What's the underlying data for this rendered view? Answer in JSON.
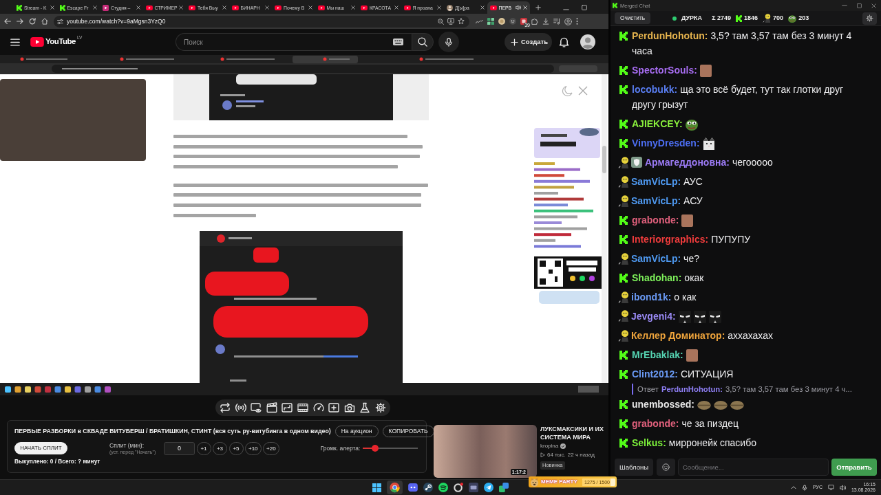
{
  "browser": {
    "tabs": [
      {
        "title": "Stream - K",
        "kind": "k",
        "selected": false,
        "audible": false
      },
      {
        "title": "Escape Fr",
        "kind": "k",
        "selected": false,
        "audible": false
      },
      {
        "title": "Студия –",
        "kind": "studio",
        "selected": false,
        "audible": false
      },
      {
        "title": "СТРИМЕР",
        "kind": "play",
        "selected": false,
        "audible": false
      },
      {
        "title": "Тебя Выу",
        "kind": "play",
        "selected": false,
        "audible": false
      },
      {
        "title": "БИНАРН",
        "kind": "play",
        "selected": false,
        "audible": false
      },
      {
        "title": "Почему В",
        "kind": "play",
        "selected": false,
        "audible": false
      },
      {
        "title": "Мы наш",
        "kind": "play",
        "selected": false,
        "audible": false
      },
      {
        "title": "КРАСОТА",
        "kind": "play",
        "selected": false,
        "audible": false
      },
      {
        "title": "Я проана",
        "kind": "play",
        "selected": false,
        "audible": false
      },
      {
        "title": "Д[ы]ра",
        "kind": "avatar",
        "selected": false,
        "audible": false
      },
      {
        "title": "ПЕРВ",
        "kind": "play",
        "selected": true,
        "audible": true
      }
    ],
    "address": "youtube.com/watch?v=9aMgsn3YzQ0",
    "extension_count": "39"
  },
  "youtube": {
    "logo": "YouTube",
    "region": "LV",
    "search": {
      "placeholder": "Поиск"
    },
    "create_button": "Создать"
  },
  "panel": {
    "title": "ПЕРВЫЕ РАЗБОРКИ в СКВАДЕ ВИТУБЕРШ / БРАТИШКИН, СТИНТ (вся суть ру-витубинга в одном видео)",
    "auction_button": "На аукцион",
    "copy_button": "КОПИРОВАТЬ",
    "start_button": "НАЧАТЬ СПЛИТ",
    "split_label": "Сплит (мин):",
    "split_hint": "(уст. перед \"Начать\")",
    "split_value": "0",
    "increments": [
      "+1",
      "+3",
      "+5",
      "+10",
      "+20"
    ],
    "alert_label": "Громк. алерта:",
    "alert_volume": {
      "level": 0.22
    },
    "bought": "Выкуплено: 0 / Всего: ? минут"
  },
  "recommendation": {
    "title": "ЛУКСМАКСИКИ И ИХ СИСТЕМА МИРА",
    "duration": "1:17:2",
    "channel": "kropina",
    "verified": true,
    "views": "64 тыс.",
    "age": "22 ч назад",
    "tag": "Новинка"
  },
  "chat": {
    "title": "Merged Chat",
    "clear_button": "Очистить",
    "online": true,
    "channel": "ДУРКА",
    "total": "Σ 2749",
    "counts": [
      {
        "kind": "k",
        "value": "1846"
      },
      {
        "kind": "mascot",
        "value": "700"
      },
      {
        "kind": "frog",
        "value": "203"
      }
    ],
    "messages": [
      {
        "kind": "message",
        "badges": [
          {
            "kind": "k"
          }
        ],
        "user": "PerdunHohotun:",
        "color": "#e6b44e",
        "text": "3,5? там 3,57 там без 3 минут 4 часа"
      },
      {
        "kind": "message",
        "badges": [
          {
            "kind": "k"
          }
        ],
        "user": "SpectorSouls:",
        "color": "#a66cf0",
        "emotes": [
          {
            "kind": "face"
          }
        ]
      },
      {
        "kind": "message",
        "badges": [
          {
            "kind": "k"
          }
        ],
        "user": "locobukk:",
        "color": "#5a7ff5",
        "text": "ща это всё будет, тут так глотки друг другу грызут"
      },
      {
        "kind": "message",
        "badges": [
          {
            "kind": "k"
          }
        ],
        "user": "AJIEKCEY:",
        "color": "#8af03c",
        "emotes": [
          {
            "kind": "frog"
          }
        ]
      },
      {
        "kind": "message",
        "badges": [
          {
            "kind": "k"
          }
        ],
        "user": "VinnyDresden:",
        "color": "#4d6ff5",
        "emotes": [
          {
            "kind": "cat"
          }
        ]
      },
      {
        "kind": "message",
        "badges": [
          {
            "kind": "mascot"
          },
          {
            "kind": "shield"
          }
        ],
        "user": "Армагеддоновна:",
        "color": "#9d7cf8",
        "text": "чегооооо"
      },
      {
        "kind": "message",
        "badges": [
          {
            "kind": "mascot"
          }
        ],
        "user": "SamVicLp:",
        "color": "#4f9af2",
        "text": "АУС"
      },
      {
        "kind": "message",
        "badges": [
          {
            "kind": "mascot"
          }
        ],
        "user": "SamVicLp:",
        "color": "#4f9af2",
        "text": "АСУ"
      },
      {
        "kind": "message",
        "badges": [
          {
            "kind": "k"
          }
        ],
        "user": "grabonde:",
        "color": "#e0607c",
        "emotes": [
          {
            "kind": "face"
          }
        ]
      },
      {
        "kind": "message",
        "badges": [
          {
            "kind": "k"
          }
        ],
        "user": "Interiorgraphics:",
        "color": "#f03c3c",
        "text": "ПУПУПУ"
      },
      {
        "kind": "message",
        "badges": [
          {
            "kind": "mascot"
          }
        ],
        "user": "SamVicLp:",
        "color": "#4f9af2",
        "text": "че?"
      },
      {
        "kind": "message",
        "badges": [
          {
            "kind": "k"
          }
        ],
        "user": "Shadohan:",
        "color": "#7df05a",
        "text": "окак"
      },
      {
        "kind": "message",
        "badges": [
          {
            "kind": "mascot"
          }
        ],
        "user": "ibond1k:",
        "color": "#6a9af5",
        "text": "о как"
      },
      {
        "kind": "message",
        "badges": [
          {
            "kind": "mascot"
          }
        ],
        "user": "Jevgeni4:",
        "color": "#9a8af5",
        "emotes": [
          {
            "kind": "mask"
          },
          {
            "kind": "mask"
          },
          {
            "kind": "mask"
          }
        ]
      },
      {
        "kind": "message",
        "badges": [
          {
            "kind": "mascot"
          }
        ],
        "user": "Келлер Доминатор:",
        "color": "#f0a53c",
        "text": "аххахахах"
      },
      {
        "kind": "message",
        "badges": [
          {
            "kind": "k"
          }
        ],
        "user": "MrEbaklak:",
        "color": "#56d6b4",
        "emotes": [
          {
            "kind": "face"
          }
        ]
      },
      {
        "kind": "message",
        "badges": [
          {
            "kind": "k"
          }
        ],
        "user": "Clint2012:",
        "color": "#6a9af5",
        "text": "СИТУАЦИЯ"
      },
      {
        "kind": "reply",
        "label": "Ответ",
        "user": "PerdunHohotun:",
        "color": "#8f7ff5",
        "text": "3,5? там 3,57 там без 3 минут 4 ч..."
      },
      {
        "kind": "message",
        "badges": [
          {
            "kind": "k"
          }
        ],
        "user": "unembossed:",
        "color": "#e8e8e8",
        "emotes": [
          {
            "kind": "bean"
          },
          {
            "kind": "bean"
          },
          {
            "kind": "bean"
          }
        ]
      },
      {
        "kind": "message",
        "badges": [
          {
            "kind": "k"
          }
        ],
        "user": "grabonde:",
        "color": "#e0607c",
        "text": "че за пиздец"
      },
      {
        "kind": "message",
        "badges": [
          {
            "kind": "k"
          }
        ],
        "user": "Selkus:",
        "color": "#7cf03a",
        "text": "мирронейк спасибо"
      }
    ],
    "templates_button": "Шаблоны",
    "input": {
      "placeholder": "Сообщение..."
    },
    "send_button": "Отправить"
  },
  "taskbar": {
    "language": "РУС",
    "time": "16:15",
    "date": "13.08.2026"
  },
  "widget": {
    "title": "MEME PARTY",
    "progress": "1275 / 1500",
    "level": 0.85
  }
}
